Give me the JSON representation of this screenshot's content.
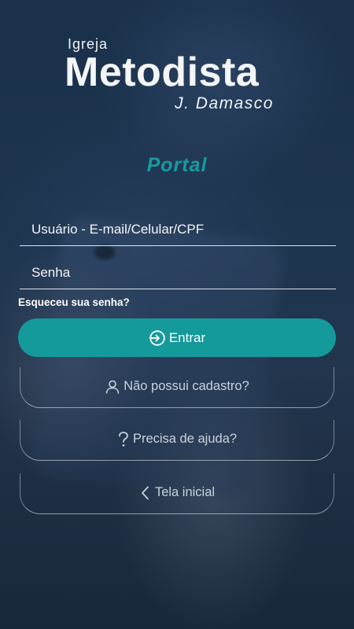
{
  "logo": {
    "top_line": "Igreja",
    "main_line": "Metodista",
    "sub_line": "J. Damasco"
  },
  "portal_title": "Portal",
  "form": {
    "user_placeholder": "Usuário - E-mail/Celular/CPF",
    "password_placeholder": "Senha",
    "forgot_label": "Esqueceu sua senha?",
    "login_label": "Entrar"
  },
  "actions": {
    "register_label": "Não possui cadastro?",
    "help_label": "Precisa de ajuda?",
    "home_label": "Tela inicial"
  },
  "icons": {
    "login": "login-arrow-icon",
    "register": "user-icon",
    "help": "question-icon",
    "home": "chevron-left-icon"
  },
  "colors": {
    "accent": "#159a9c",
    "portal_title": "#179ba0",
    "text": "#ffffff",
    "muted_text": "#c9d2de"
  }
}
